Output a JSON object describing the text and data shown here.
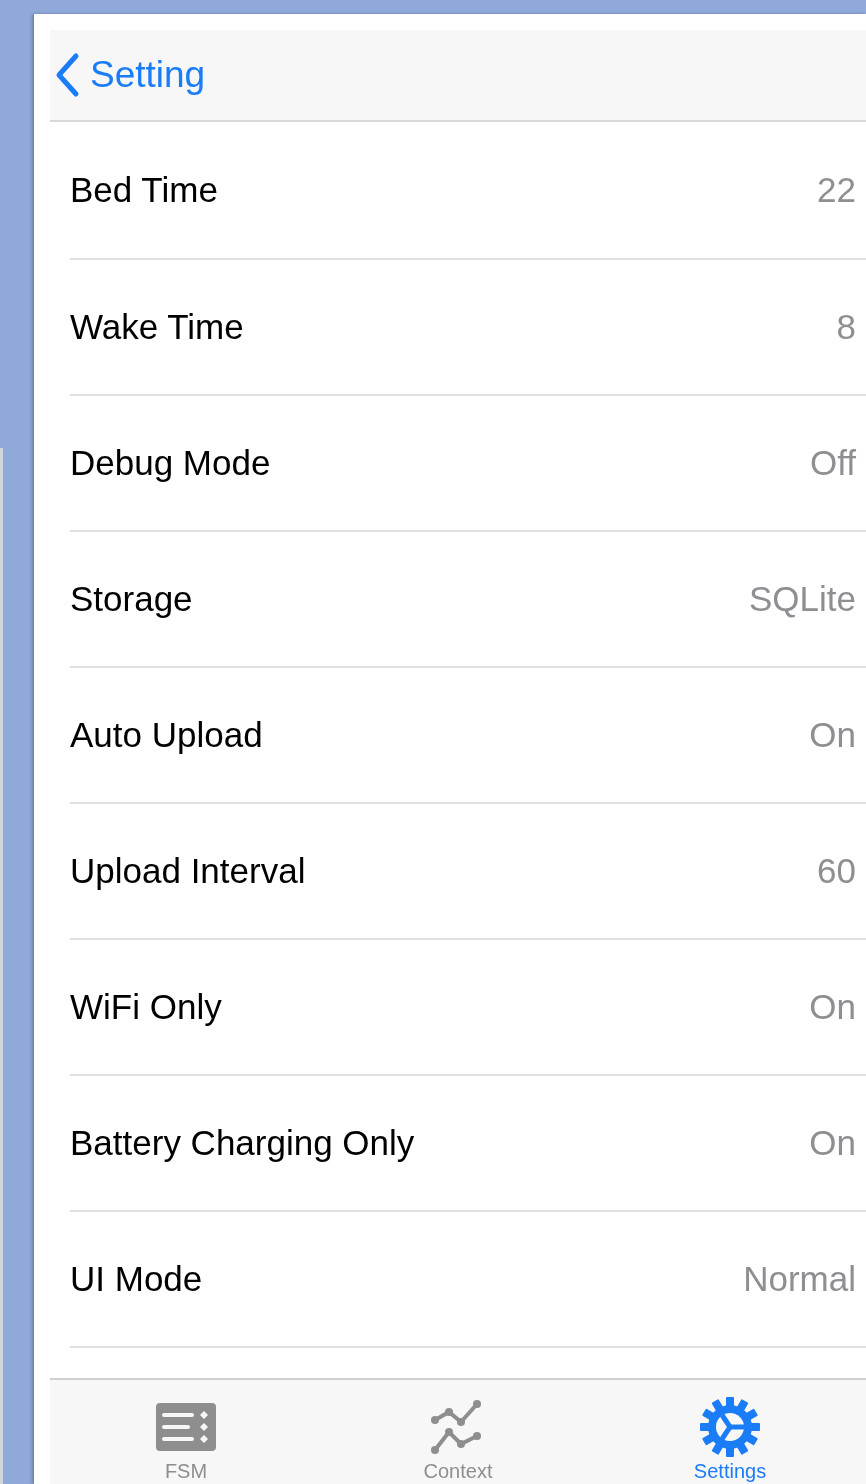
{
  "nav_bar": {
    "back_label": "Setting"
  },
  "settings": [
    {
      "label": "Bed Time",
      "value": "22"
    },
    {
      "label": "Wake Time",
      "value": "8"
    },
    {
      "label": "Debug Mode",
      "value": "Off"
    },
    {
      "label": "Storage",
      "value": "SQLite"
    },
    {
      "label": "Auto Upload",
      "value": "On"
    },
    {
      "label": "Upload Interval",
      "value": "60"
    },
    {
      "label": "WiFi Only",
      "value": "On"
    },
    {
      "label": "Battery Charging Only",
      "value": "On"
    },
    {
      "label": "UI Mode",
      "value": "Normal"
    }
  ],
  "tab_bar": [
    {
      "kind": "list",
      "label": "FSM",
      "selected": false
    },
    {
      "kind": "chart",
      "label": "Context",
      "selected": false
    },
    {
      "kind": "gear",
      "label": "Settings",
      "selected": true
    }
  ]
}
